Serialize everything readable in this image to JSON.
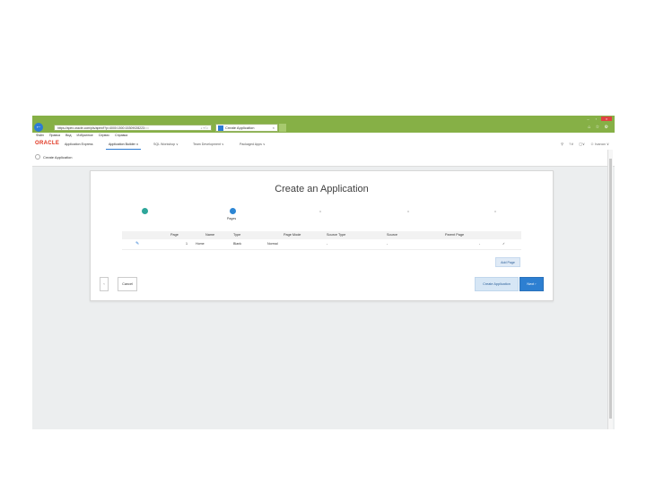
{
  "browser": {
    "address_url": "https://apex.oracle.com/pls/apex/f?p=4000:1500:15309028223:::::",
    "tab_title": "Create Application",
    "window_controls": [
      "–",
      "▫",
      "×"
    ],
    "nav_icons": "⌂ ☆ ⚙"
  },
  "menubar": [
    "Файл",
    "Правка",
    "Вид",
    "Избранное",
    "Сервис",
    "Справка"
  ],
  "apex": {
    "logo": "ORACLE",
    "builder_label": "Application Express",
    "tabs": [
      {
        "label": "Application Builder",
        "caret": "∨"
      },
      {
        "label": "SQL Workshop",
        "caret": "∨"
      },
      {
        "label": "Team Development",
        "caret": "∨"
      },
      {
        "label": "Packaged Apps",
        "caret": "∨"
      }
    ],
    "right_nav": {
      "search": "⚲",
      "help": "?∨",
      "chat": "▢∨",
      "user": "☺ Ivanov ∨"
    }
  },
  "breadcrumb": {
    "label": "Create Application"
  },
  "wizard": {
    "title": "Create an Application",
    "current_step_label": "Pages",
    "table": {
      "headers": [
        "Page",
        "Name",
        "Type",
        "Page Mode",
        "Source Type",
        "Source",
        "Parent Page"
      ],
      "rows": [
        {
          "edit_icon": "✎",
          "page": "1",
          "name": "Home",
          "type": "Blank",
          "mode": "Normal",
          "source_type": "-",
          "source": "-",
          "parent": "-",
          "extra": "✓"
        }
      ]
    },
    "add_page_label": "Add Page",
    "prev_label": "‹",
    "cancel_label": "Cancel",
    "create_label": "Create Application",
    "next_label": "Next ›"
  },
  "colors": {
    "browser_chrome": "#86b046",
    "accent_blue": "#2d7fd1",
    "step_done": "#2ea69a",
    "oracle_red": "#e0331e"
  }
}
